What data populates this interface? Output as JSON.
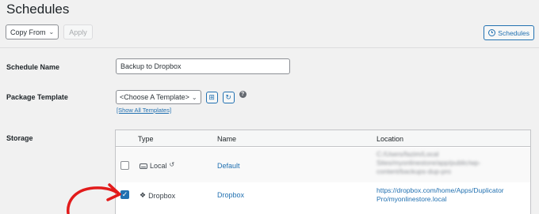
{
  "page": {
    "title": "Schedules"
  },
  "toolbar": {
    "copy_from_label": "Copy From",
    "apply_label": "Apply",
    "schedules_label": "Schedules"
  },
  "form": {
    "schedule_name_label": "Schedule Name",
    "schedule_name_value": "Backup to Dropbox",
    "package_template_label": "Package Template",
    "template_select_value": "<Choose A Template>",
    "show_all_templates_link": "[Show All Templates]",
    "storage_label": "Storage"
  },
  "storage_table": {
    "headers": {
      "type": "Type",
      "name": "Name",
      "location": "Location"
    },
    "rows": [
      {
        "checked": false,
        "type": "Local",
        "name": "Default",
        "location_line1": "C:/Users/fazim/Local",
        "location_line2": "Sites/myonlinestore/app/public/wp-",
        "location_line3": "content/backups-dup-pro"
      },
      {
        "checked": true,
        "type": "Dropbox",
        "name": "Dropbox",
        "location_line1": "https://dropbox.com/home/Apps/Duplicator",
        "location_line2": "Pro/myonlinestore.local"
      }
    ]
  },
  "colors": {
    "accent": "#2271b1",
    "annotation_arrow": "#e21b1b"
  }
}
